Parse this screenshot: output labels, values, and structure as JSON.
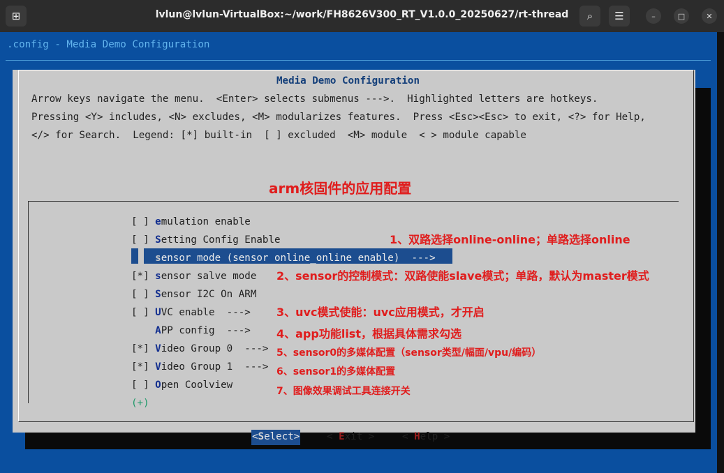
{
  "window": {
    "title": "lvlun@lvlun-VirtualBox:~/work/FH8626V300_RT_V1.0.0_20250627/rt-thread"
  },
  "terminal": {
    "header": ".config - Media Demo Configuration"
  },
  "dialog": {
    "title": "Media Demo Configuration",
    "help_lines": [
      "Arrow keys navigate the menu.  <Enter> selects submenus --->.  Highlighted letters are hotkeys.",
      "Pressing <Y> includes, <N> excludes, <M> modularizes features.  Press <Esc><Esc> to exit, <?> for Help,",
      "</> for Search.  Legend: [*] built-in  [ ] excluded  <M> module  < > module capable"
    ],
    "annotation_title": "arm核固件的应用配置",
    "items": [
      {
        "prefix": "[ ] ",
        "hotkey": "e",
        "rest": "mulation enable"
      },
      {
        "prefix": "[ ] ",
        "hotkey": "S",
        "rest": "etting Config Enable"
      },
      {
        "prefix": "    ",
        "hotkey": "s",
        "rest": "ensor mode (sensor online_online enable)  --->"
      },
      {
        "prefix": "[*] ",
        "hotkey": "s",
        "rest": "ensor salve mode"
      },
      {
        "prefix": "[ ] ",
        "hotkey": "S",
        "rest": "ensor I2C On ARM"
      },
      {
        "prefix": "[ ] ",
        "hotkey": "U",
        "rest": "VC enable  --->"
      },
      {
        "prefix": "    ",
        "hotkey": "A",
        "rest": "PP config  --->"
      },
      {
        "prefix": "[*] ",
        "hotkey": "V",
        "rest": "ideo Group 0  --->"
      },
      {
        "prefix": "[*] ",
        "hotkey": "V",
        "rest": "ideo Group 1  --->"
      },
      {
        "prefix": "[ ] ",
        "hotkey": "O",
        "rest": "pen Coolview"
      }
    ],
    "more_indicator": "(+)",
    "annotations": [
      "1、双路选择online-online；单路选择online",
      "2、sensor的控制模式：双路使能slave模式；单路，默认为master模式",
      "3、uvc模式使能：uvc应用模式，才开启",
      "4、app功能list，根据具体需求勾选",
      "5、sensor0的多媒体配置（sensor类型/幅面/vpu/编码）",
      "6、sensor1的多媒体配置",
      "7、图像效果调试工具连接开关"
    ],
    "buttons": {
      "select": {
        "pre": "<",
        "hotkey": "S",
        "post": "elect>"
      },
      "exit": {
        "pre": "< ",
        "hotkey": "E",
        "post": "xit >"
      },
      "help": {
        "pre": "< ",
        "hotkey": "H",
        "post": "elp >"
      }
    }
  },
  "colors": {
    "terminal_bg": "#0a4f9f",
    "dialog_bg": "#c9c9c9",
    "highlight": "#1c4d8f",
    "annotation_red": "#e01d1d"
  }
}
